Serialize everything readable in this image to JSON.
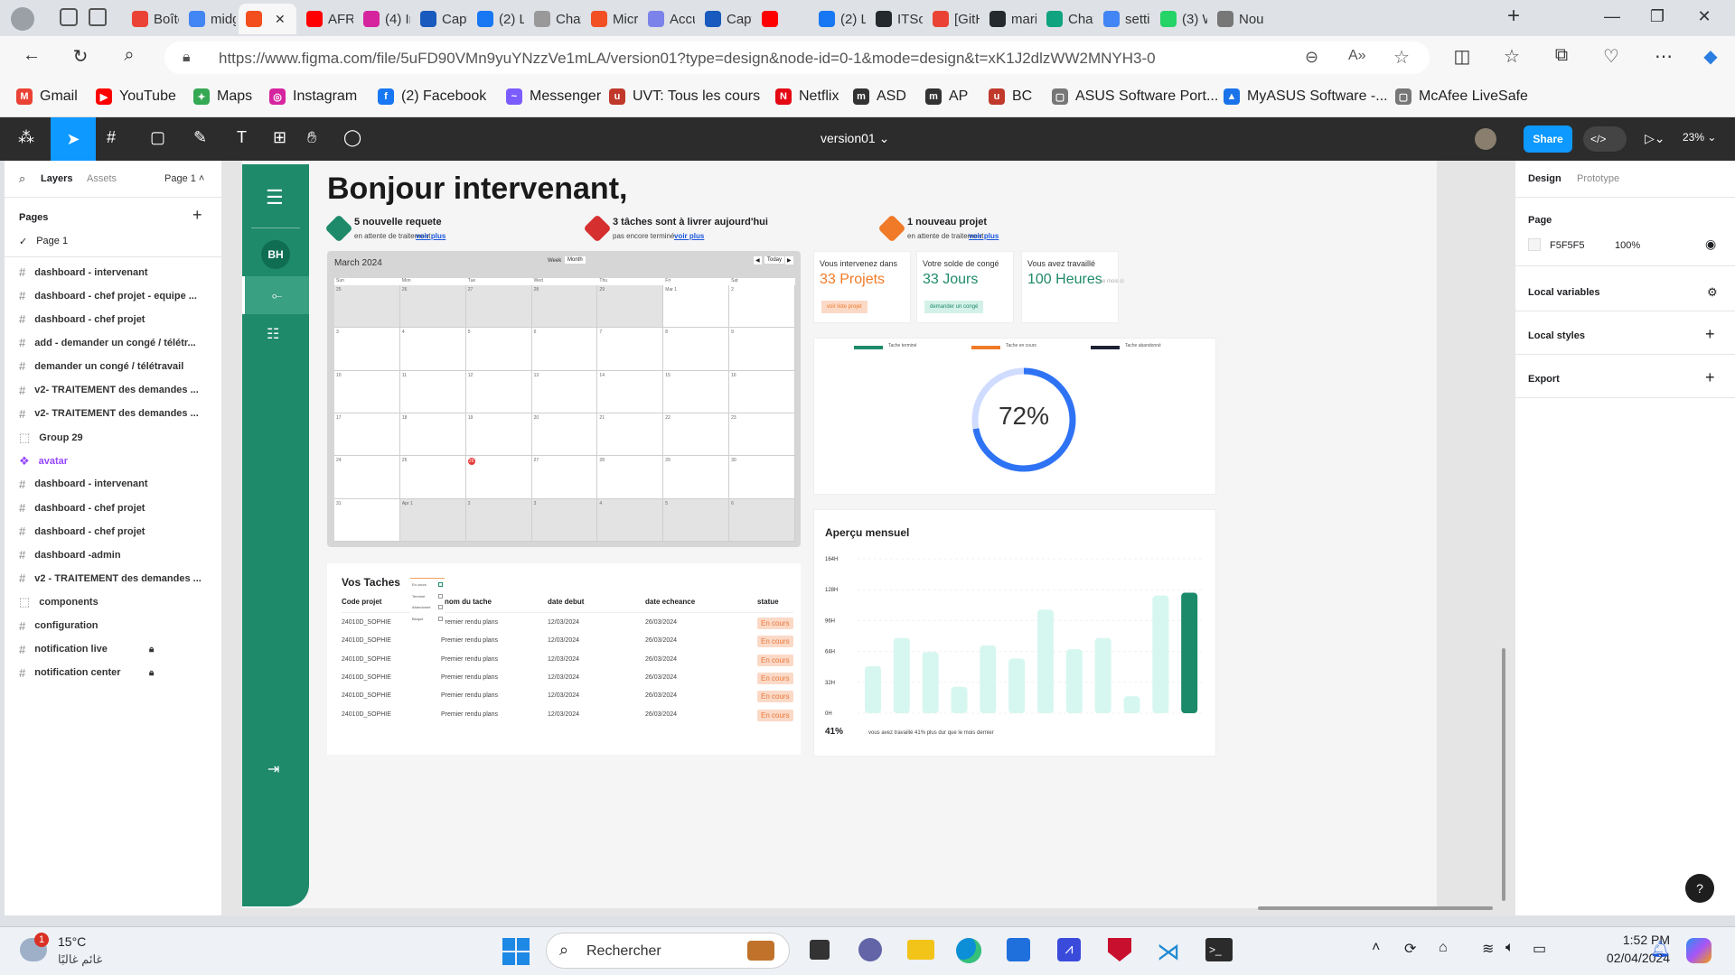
{
  "browser": {
    "tabs": [
      {
        "label": "Boîte",
        "color": "#ea4335"
      },
      {
        "label": "midg",
        "color": "#4285f4"
      },
      {
        "label": "",
        "color": "#f24e1e",
        "active": true
      },
      {
        "label": "AFRO",
        "color": "#ff0000"
      },
      {
        "label": "(4) In",
        "color": "#d6249f"
      },
      {
        "label": "Capt",
        "color": "#185abd"
      },
      {
        "label": "(2) Lo",
        "color": "#1877f2"
      },
      {
        "label": "Chat",
        "color": "#999999"
      },
      {
        "label": "Micr",
        "color": "#f25022"
      },
      {
        "label": "Accu",
        "color": "#7b83eb"
      },
      {
        "label": "Capt",
        "color": "#185abd"
      },
      {
        "label": "",
        "color": "#ff0000"
      },
      {
        "label": "(2) Li",
        "color": "#1877f2"
      },
      {
        "label": "ITSol",
        "color": "#24292e"
      },
      {
        "label": "[GitH",
        "color": "#ea4335"
      },
      {
        "label": "mari",
        "color": "#24292e"
      },
      {
        "label": "Chat",
        "color": "#10a37f"
      },
      {
        "label": "setti",
        "color": "#4285f4"
      },
      {
        "label": "(3) W",
        "color": "#25d366"
      },
      {
        "label": "Nou",
        "color": "#777777"
      }
    ],
    "url": "https://www.figma.com/file/5uFD90VMn9yuYNzzVe1mLA/version01?type=design&node-id=0-1&mode=design&t=xK1J2dlzWW2MNYH3-0",
    "bookmarks": [
      {
        "label": "Gmail",
        "color": "#ea4335",
        "glyph": "M"
      },
      {
        "label": "YouTube",
        "color": "#ff0000",
        "glyph": "▶"
      },
      {
        "label": "Maps",
        "color": "#34a853",
        "glyph": "✦"
      },
      {
        "label": "Instagram",
        "color": "#d6249f",
        "glyph": "◎"
      },
      {
        "label": "(2) Facebook",
        "color": "#1877f2",
        "glyph": "f"
      },
      {
        "label": "Messenger",
        "color": "#7b5cff",
        "glyph": "~"
      },
      {
        "label": "UVT: Tous les cours",
        "color": "#c0392b",
        "glyph": "u"
      },
      {
        "label": "Netflix",
        "color": "#e50914",
        "glyph": "N"
      },
      {
        "label": "ASD",
        "color": "#333333",
        "glyph": "m"
      },
      {
        "label": "AP",
        "color": "#333333",
        "glyph": "m"
      },
      {
        "label": "BC",
        "color": "#c0392b",
        "glyph": "u"
      },
      {
        "label": "ASUS Software Port...",
        "color": "#777777",
        "glyph": "▢"
      },
      {
        "label": "MyASUS Software -...",
        "color": "#1a73e8",
        "glyph": "▲"
      },
      {
        "label": "McAfee LiveSafe",
        "color": "#777777",
        "glyph": "▢"
      }
    ]
  },
  "figma": {
    "file_title": "version01",
    "share_label": "Share",
    "zoom": "23%",
    "left_tabs": {
      "layers": "Layers",
      "assets": "Assets",
      "page": "Page 1"
    },
    "pages_header": "Pages",
    "current_page": "Page 1",
    "layers": [
      {
        "label": "dashboard - intervenant",
        "kind": "frame"
      },
      {
        "label": "dashboard - chef projet - equipe ...",
        "kind": "frame"
      },
      {
        "label": "dashboard - chef projet",
        "kind": "frame"
      },
      {
        "label": "add - demander un congé / télétr...",
        "kind": "frame"
      },
      {
        "label": "demander un congé / télétravail",
        "kind": "frame"
      },
      {
        "label": "v2- TRAITEMENT des demandes ...",
        "kind": "frame"
      },
      {
        "label": "v2- TRAITEMENT des demandes ...",
        "kind": "frame"
      },
      {
        "label": "Group 29",
        "kind": "group"
      },
      {
        "label": "avatar",
        "kind": "component"
      },
      {
        "label": "dashboard - intervenant",
        "kind": "frame"
      },
      {
        "label": "dashboard - chef projet",
        "kind": "frame"
      },
      {
        "label": "dashboard - chef projet",
        "kind": "frame"
      },
      {
        "label": "dashboard -admin",
        "kind": "frame"
      },
      {
        "label": "v2 - TRAITEMENT des demandes ...",
        "kind": "frame"
      },
      {
        "label": "components",
        "kind": "group"
      },
      {
        "label": "configuration",
        "kind": "frame"
      },
      {
        "label": "notification live",
        "kind": "frame",
        "locked": true
      },
      {
        "label": "notification center",
        "kind": "frame",
        "locked": true
      }
    ],
    "right": {
      "tabs": {
        "design": "Design",
        "prototype": "Prototype"
      },
      "page_label": "Page",
      "page_color": "F5F5F5",
      "page_opacity": "100%",
      "local_variables": "Local variables",
      "local_styles": "Local styles",
      "export": "Export"
    }
  },
  "design": {
    "avatar_initials": "BH",
    "greeting": "Bonjour intervenant,",
    "notices": [
      {
        "title": "5 nouvelle requete",
        "sub": "en attente de traitement",
        "link": "voir plus",
        "color": "#1e8a6a"
      },
      {
        "title": "3 tâches sont à livrer aujourd'hui",
        "sub": "pas encore terminé",
        "link": "voir plus",
        "color": "#d62f2f"
      },
      {
        "title": "1 nouveau projet",
        "sub": "en attente de traitement",
        "link": "voir plus",
        "color": "#f07a28"
      }
    ],
    "calendar": {
      "month": "March 2024",
      "view_week": "Week",
      "view_month": "Month",
      "today": "Today",
      "days": [
        "Sun",
        "Mon",
        "Tue",
        "Wed",
        "Thu",
        "Fri",
        "Sat"
      ],
      "weeks": [
        [
          "25",
          "26",
          "27",
          "28",
          "29",
          "Mar 1",
          "2"
        ],
        [
          "3",
          "4",
          "5",
          "6",
          "7",
          "8",
          "9"
        ],
        [
          "10",
          "11",
          "12",
          "13",
          "14",
          "15",
          "16"
        ],
        [
          "17",
          "18",
          "19",
          "20",
          "21",
          "22",
          "23"
        ],
        [
          "24",
          "25",
          "26",
          "27",
          "28",
          "29",
          "30"
        ],
        [
          "31",
          "Apr 1",
          "2",
          "3",
          "4",
          "5",
          "6"
        ]
      ],
      "highlight": "26"
    },
    "stats": [
      {
        "label": "Vous intervenez dans",
        "value": "33 Projets",
        "button": "voir liste projet",
        "color": "#f07a28",
        "btn_bg": "#fbd9c7"
      },
      {
        "label": "Votre solde de congé",
        "value": "33 Jours",
        "button": "demander un congé",
        "color": "#1e8a6a",
        "btn_bg": "#d3f1e8"
      },
      {
        "label": "Vous avez travaillé",
        "value": "100 Heures",
        "suffix": "ce mois ci",
        "color": "#1e8a6a"
      }
    ],
    "donut": {
      "legend": [
        {
          "label": "Tache terminé",
          "color": "#1e8a6a"
        },
        {
          "label": "Tache en cours",
          "color": "#f07a28"
        },
        {
          "label": "Tache abandonné",
          "color": "#1f2233"
        }
      ],
      "value_label": "72%",
      "value": 72
    },
    "tasks": {
      "title": "Vos Taches",
      "columns": [
        "Code projet",
        "nom du tache",
        "date debut",
        "date  echeance",
        "statue"
      ],
      "filters": [
        "En cours",
        "Terminé",
        "Abandonné",
        "Bloqué"
      ],
      "rows": [
        [
          "24010D_SOPHIE",
          "Premier rendu plans",
          "12/03/2024",
          "26/03/2024",
          "En cours"
        ],
        [
          "24010D_SOPHIE",
          "Premier rendu plans",
          "12/03/2024",
          "26/03/2024",
          "En cours"
        ],
        [
          "24010D_SOPHIE",
          "Premier rendu plans",
          "12/03/2024",
          "26/03/2024",
          "En cours"
        ],
        [
          "24010D_SOPHIE",
          "Premier rendu plans",
          "12/03/2024",
          "26/03/2024",
          "En cours"
        ],
        [
          "24010D_SOPHIE",
          "Premier rendu plans",
          "12/03/2024",
          "26/03/2024",
          "En cours"
        ],
        [
          "24010D_SOPHIE",
          "Premier rendu plans",
          "12/03/2024",
          "26/03/2024",
          "En cours"
        ]
      ]
    },
    "chart_data": {
      "type": "bar",
      "title": "Aperçu mensuel",
      "ylim": [
        0,
        164
      ],
      "yticks": [
        "164H",
        "128H",
        "96H",
        "64H",
        "32H",
        "0H"
      ],
      "values": [
        50,
        80,
        65,
        28,
        72,
        58,
        110,
        68,
        80,
        18,
        125,
        128
      ],
      "highlight_index": 11,
      "colors": {
        "bar": "#d6f7ef",
        "highlight": "#1a8a6b"
      },
      "footer_value": "41%",
      "footer_text": "vous avez travaillé 41% plus dur que le mois dernier"
    }
  },
  "taskbar": {
    "weather_temp": "15°C",
    "weather_desc": "غائم غالبًا",
    "weather_badge": "1",
    "search_placeholder": "Rechercher",
    "time": "1:52 PM",
    "date": "02/04/2024"
  }
}
